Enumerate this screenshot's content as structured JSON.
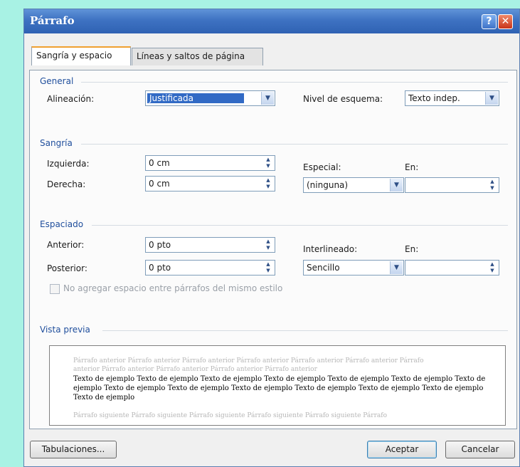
{
  "window": {
    "title": "Párrafo",
    "help_glyph": "?",
    "close_glyph": "✕"
  },
  "tabs": [
    {
      "label": "Sangría y espacio",
      "active": true
    },
    {
      "label": "Líneas y saltos de página",
      "active": false
    }
  ],
  "general": {
    "title": "General",
    "alignment_label": "Alineación:",
    "alignment_value": "Justificada",
    "outline_label": "Nivel de esquema:",
    "outline_value": "Texto indep."
  },
  "indent": {
    "title": "Sangría",
    "left_label": "Izquierda:",
    "left_value": "0 cm",
    "right_label": "Derecha:",
    "right_value": "0 cm",
    "special_label": "Especial:",
    "special_value": "(ninguna)",
    "by_label": "En:",
    "by_value": ""
  },
  "spacing": {
    "title": "Espaciado",
    "before_label": "Anterior:",
    "before_value": "0 pto",
    "after_label": "Posterior:",
    "after_value": "0 pto",
    "line_label": "Interlineado:",
    "line_value": "Sencillo",
    "at_label": "En:",
    "at_value": "",
    "no_space_label": "No agregar espacio entre párrafos del mismo estilo",
    "no_space_checked": false
  },
  "preview": {
    "title": "Vista previa",
    "prev_line1": "Párrafo anterior Párrafo anterior Párrafo anterior Párrafo anterior Párrafo anterior Párrafo anterior Párrafo",
    "prev_line2": "anterior Párrafo anterior Párrafo anterior Párrafo anterior Párrafo anterior",
    "sample_text": "Texto de ejemplo Texto de ejemplo Texto de ejemplo Texto de ejemplo Texto de ejemplo Texto de ejemplo Texto de ejemplo Texto de ejemplo Texto de ejemplo Texto de ejemplo Texto de ejemplo Texto de ejemplo Texto de ejemplo Texto de ejemplo",
    "next_line": "Párrafo siguiente Párrafo siguiente Párrafo siguiente Párrafo siguiente Párrafo siguiente Párrafo"
  },
  "buttons": {
    "tabs_label": "Tabulaciones...",
    "ok_label": "Aceptar",
    "cancel_label": "Cancelar"
  },
  "icons": {
    "dropdown": "chevron-down-icon",
    "spinner": "spin-updown-icon"
  },
  "colors": {
    "background": "#a8f2e4",
    "titlebar": "#3e72c2",
    "group_label": "#1f4e9c",
    "selection": "#316ac5"
  }
}
